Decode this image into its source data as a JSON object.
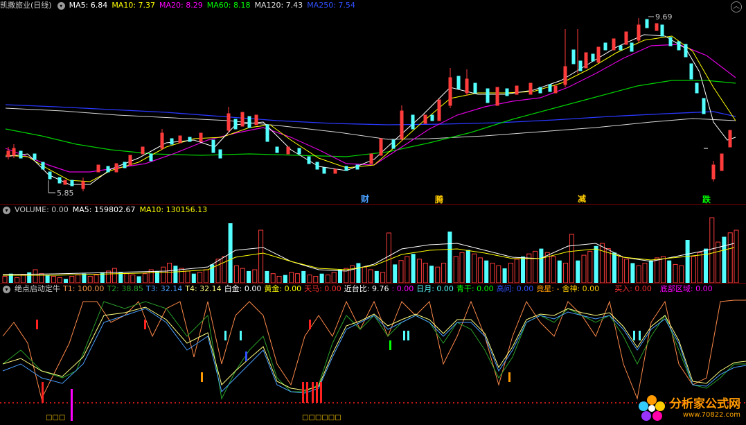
{
  "main_header": {
    "title": "凯撒旅业(日线)",
    "ma5": "MA5: 6.84",
    "ma10": "MA10: 7.37",
    "ma20": "MA20: 8.29",
    "ma60": "MA60: 8.18",
    "ma120": "MA120: 7.43",
    "ma250": "MA250: 7.54"
  },
  "price_labels": {
    "high": "9.69",
    "low": "5.85"
  },
  "event_markers": [
    {
      "text": "财",
      "color": "#4aa0ff"
    },
    {
      "text": "腾",
      "color": "#ffcc00"
    },
    {
      "text": "减",
      "color": "#ffcc00"
    },
    {
      "text": "跌",
      "color": "#00ff00"
    }
  ],
  "volume_header": {
    "label": "VOLUME: 0.00",
    "ma5": "MA5: 159802.67",
    "ma10": "MA10: 130156.13"
  },
  "indicator_header": {
    "name": "绝点启动定牛",
    "t1": "T1: 100.00",
    "t2": "T2: 38.85",
    "t3": "T3: 32.14",
    "t4": "T4: 32.14",
    "baijin": "白金: 0.00",
    "huangjin": "黄金: 0.00",
    "tianma": "天马: 0.00",
    "jintaibi": "近台比: 9.76",
    "blank": ": 0.00",
    "riyue": "日月: 0.00",
    "qinggan": "青干: 0.00",
    "gaowen": "高问: 0.00",
    "jingxing": "竟星: -",
    "sheshen": "舍神: 0.00",
    "mairu": "买入: 0.00",
    "dibu": "底部区域: 0.00"
  },
  "bottom_marks": {
    "left": "□□□",
    "mid": "□□□□□□"
  },
  "watermark": {
    "text": "分析家公式网",
    "url": "www.70822.com"
  },
  "colors": {
    "up": "#ff3c3c",
    "down": "#54ffff",
    "ma5": "#ffffff",
    "ma10": "#ffff00",
    "ma20": "#ff00ff",
    "ma60": "#00ff00",
    "ma120": "#e0e0e0",
    "ma250": "#3040ff"
  }
}
